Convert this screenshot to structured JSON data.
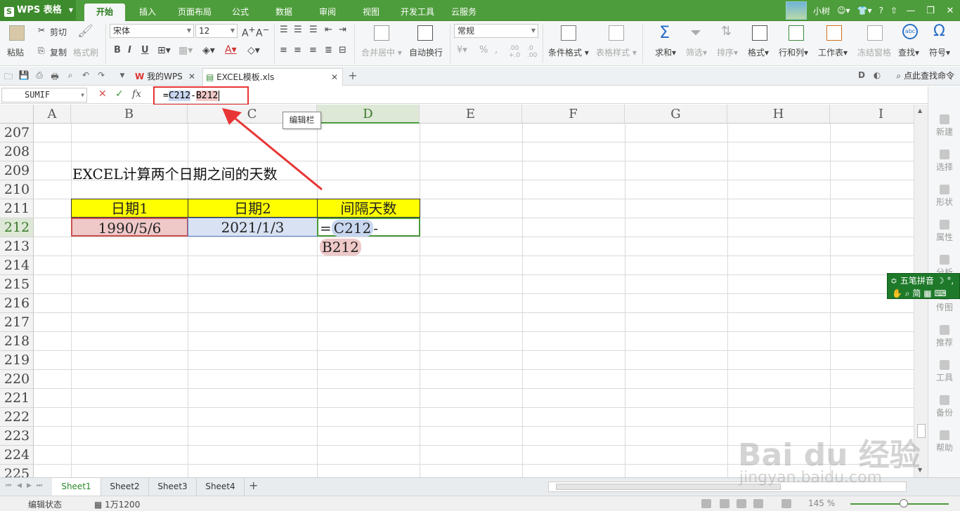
{
  "app": {
    "logo": "WPS 表格",
    "menu_tabs": [
      "开始",
      "插入",
      "页面布局",
      "公式",
      "数据",
      "审阅",
      "视图",
      "开发工具",
      "云服务"
    ],
    "user": "小树",
    "help": "?"
  },
  "ribbon": {
    "paste": "粘贴",
    "cut": "剪切",
    "copy": "复制",
    "format_painter": "格式刷",
    "font_name": "宋体",
    "font_size": "12",
    "merge_center": "合并居中",
    "wrap_text": "自动换行",
    "number_format": "常规",
    "cond_format": "条件格式",
    "table_style": "表格样式",
    "sum": "求和",
    "filter": "筛选",
    "sort": "排序",
    "format": "格式",
    "row_col": "行和列",
    "worksheet": "工作表",
    "freeze": "冻结窗格",
    "find": "查找",
    "symbol": "符号"
  },
  "tabs": {
    "my_wps": "我的WPS",
    "file": "EXCEL模板.xls",
    "find_command": "点此查找命令"
  },
  "formula_bar": {
    "name_box": "SUMIF",
    "fx": "fx",
    "formula_eq": "=",
    "ref1": "C212",
    "minus": "-",
    "ref2": "B212"
  },
  "tooltip": "编辑栏",
  "grid": {
    "columns": [
      "A",
      "B",
      "C",
      "D",
      "E",
      "F",
      "G",
      "H",
      "I"
    ],
    "rows": [
      "207",
      "208",
      "209",
      "210",
      "211",
      "212",
      "213",
      "214",
      "215",
      "216",
      "217",
      "218",
      "219",
      "220",
      "221",
      "222",
      "223",
      "224",
      "225"
    ],
    "title": "EXCEL计算两个日期之间的天数",
    "header_row": [
      "日期1",
      "日期2",
      "间隔天数"
    ],
    "data_row": [
      "1990/5/6",
      "2021/1/3"
    ]
  },
  "side_panel": [
    "新建",
    "选择",
    "形状",
    "属性",
    "分析",
    "传图",
    "推荐",
    "工具",
    "备份",
    "帮助"
  ],
  "ime": {
    "name": "五笔拼音",
    "mode": "简"
  },
  "sheets": [
    "Sheet1",
    "Sheet2",
    "Sheet3",
    "Sheet4"
  ],
  "status": {
    "mode": "编辑状态",
    "count": "1万1200",
    "zoom": "145 %"
  },
  "watermark": {
    "main": "Bai du 经验",
    "url": "jingyan.baidu.com"
  },
  "colors": {
    "brand_green": "#4e9d3c",
    "header_yellow": "#ffff00",
    "ref_blue": "#c8d7ef",
    "ref_red": "#efc8c8",
    "highlight_red": "#e83535"
  }
}
